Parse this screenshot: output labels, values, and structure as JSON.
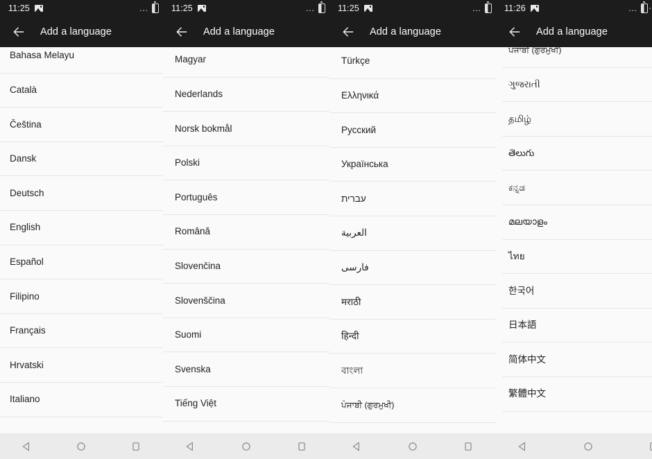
{
  "app": {
    "title": "Add a language",
    "back_icon": "arrow-back-icon",
    "bg_color": "#fafafa",
    "appbar_color": "#1c1c1c",
    "divider_color": "#e6e6e6",
    "navbar_color": "#ebebeb"
  },
  "navbar": {
    "back_label": "back-triangle",
    "home_label": "home-circle",
    "recents_label": "recents-square"
  },
  "panels": [
    {
      "id": "panel-1",
      "status": {
        "time": "11:25",
        "image_icon": "image-icon",
        "dots_icon": "more-dots-icon",
        "battery_icon": "battery-icon"
      },
      "title": "Add a language",
      "offset": 12,
      "languages": [
        "Bahasa Melayu",
        "Català",
        "Čeština",
        "Dansk",
        "Deutsch",
        "English",
        "Español",
        "Filipino",
        "Français",
        "Hrvatski",
        "Italiano"
      ]
    },
    {
      "id": "panel-2",
      "status": {
        "time": "11:25",
        "image_icon": "image-icon",
        "dots_icon": "more-dots-icon",
        "battery_icon": "battery-icon"
      },
      "title": "Add a language",
      "offset": 6,
      "languages": [
        "Magyar",
        "Nederlands",
        "Norsk bokmål",
        "Polski",
        "Português",
        "Română",
        "Slovenčina",
        "Slovenščina",
        "Suomi",
        "Svenska",
        "Tiếng Việt"
      ]
    },
    {
      "id": "panel-3",
      "status": {
        "time": "11:25",
        "image_icon": "image-icon",
        "dots_icon": "more-dots-icon",
        "battery_icon": "battery-icon"
      },
      "title": "Add a language",
      "offset": 4,
      "languages": [
        "Türkçe",
        "Ελληνικά",
        "Русский",
        "Українська",
        "עברית",
        "العربية",
        "فارسی",
        "मराठी",
        "हिन्दी",
        "বাংলা",
        "ਪੰਜਾਬੀ (ਗੁਰਮੁਖੀ)"
      ]
    },
    {
      "id": "panel-4",
      "status": {
        "time": "11:26",
        "image_icon": "image-icon",
        "dots_icon": "more-dots-icon",
        "battery_icon": "battery-icon"
      },
      "title": "Add a language",
      "offset": 20,
      "languages": [
        "ਪੰਜਾਬੀ (ਗੁਰਮੁਖੀ)",
        "ગુજરાતી",
        "தமிழ்",
        "తెలుగు",
        "ಕನ್ನಡ",
        "മലയാളം",
        "ไทย",
        "한국어",
        "日本語",
        "简体中文",
        "繁體中文"
      ]
    }
  ]
}
